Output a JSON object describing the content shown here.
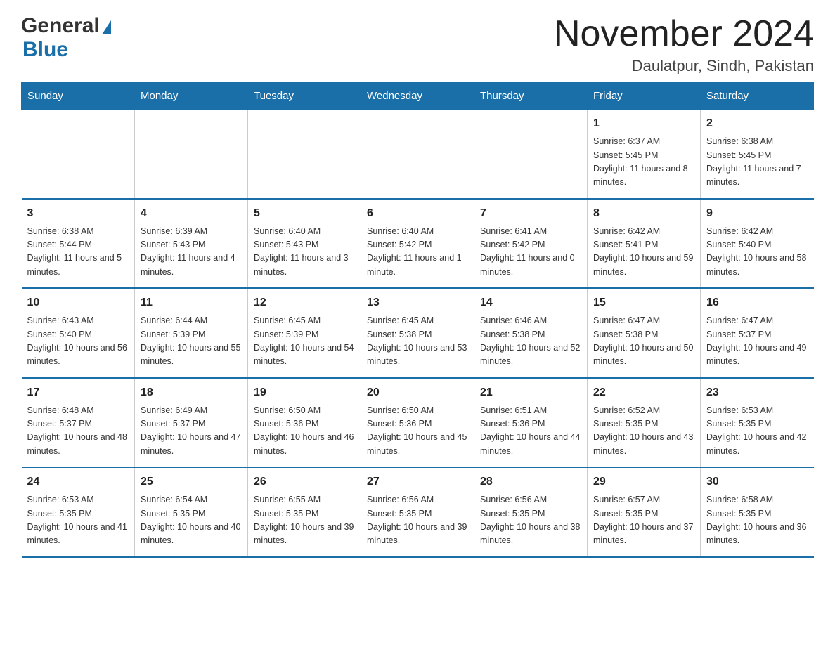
{
  "logo": {
    "general": "General",
    "blue": "Blue",
    "tagline": "GeneralBlue"
  },
  "title": "November 2024",
  "subtitle": "Daulatpur, Sindh, Pakistan",
  "days_of_week": [
    "Sunday",
    "Monday",
    "Tuesday",
    "Wednesday",
    "Thursday",
    "Friday",
    "Saturday"
  ],
  "weeks": [
    [
      {
        "day": "",
        "info": ""
      },
      {
        "day": "",
        "info": ""
      },
      {
        "day": "",
        "info": ""
      },
      {
        "day": "",
        "info": ""
      },
      {
        "day": "",
        "info": ""
      },
      {
        "day": "1",
        "info": "Sunrise: 6:37 AM\nSunset: 5:45 PM\nDaylight: 11 hours and 8 minutes."
      },
      {
        "day": "2",
        "info": "Sunrise: 6:38 AM\nSunset: 5:45 PM\nDaylight: 11 hours and 7 minutes."
      }
    ],
    [
      {
        "day": "3",
        "info": "Sunrise: 6:38 AM\nSunset: 5:44 PM\nDaylight: 11 hours and 5 minutes."
      },
      {
        "day": "4",
        "info": "Sunrise: 6:39 AM\nSunset: 5:43 PM\nDaylight: 11 hours and 4 minutes."
      },
      {
        "day": "5",
        "info": "Sunrise: 6:40 AM\nSunset: 5:43 PM\nDaylight: 11 hours and 3 minutes."
      },
      {
        "day": "6",
        "info": "Sunrise: 6:40 AM\nSunset: 5:42 PM\nDaylight: 11 hours and 1 minute."
      },
      {
        "day": "7",
        "info": "Sunrise: 6:41 AM\nSunset: 5:42 PM\nDaylight: 11 hours and 0 minutes."
      },
      {
        "day": "8",
        "info": "Sunrise: 6:42 AM\nSunset: 5:41 PM\nDaylight: 10 hours and 59 minutes."
      },
      {
        "day": "9",
        "info": "Sunrise: 6:42 AM\nSunset: 5:40 PM\nDaylight: 10 hours and 58 minutes."
      }
    ],
    [
      {
        "day": "10",
        "info": "Sunrise: 6:43 AM\nSunset: 5:40 PM\nDaylight: 10 hours and 56 minutes."
      },
      {
        "day": "11",
        "info": "Sunrise: 6:44 AM\nSunset: 5:39 PM\nDaylight: 10 hours and 55 minutes."
      },
      {
        "day": "12",
        "info": "Sunrise: 6:45 AM\nSunset: 5:39 PM\nDaylight: 10 hours and 54 minutes."
      },
      {
        "day": "13",
        "info": "Sunrise: 6:45 AM\nSunset: 5:38 PM\nDaylight: 10 hours and 53 minutes."
      },
      {
        "day": "14",
        "info": "Sunrise: 6:46 AM\nSunset: 5:38 PM\nDaylight: 10 hours and 52 minutes."
      },
      {
        "day": "15",
        "info": "Sunrise: 6:47 AM\nSunset: 5:38 PM\nDaylight: 10 hours and 50 minutes."
      },
      {
        "day": "16",
        "info": "Sunrise: 6:47 AM\nSunset: 5:37 PM\nDaylight: 10 hours and 49 minutes."
      }
    ],
    [
      {
        "day": "17",
        "info": "Sunrise: 6:48 AM\nSunset: 5:37 PM\nDaylight: 10 hours and 48 minutes."
      },
      {
        "day": "18",
        "info": "Sunrise: 6:49 AM\nSunset: 5:37 PM\nDaylight: 10 hours and 47 minutes."
      },
      {
        "day": "19",
        "info": "Sunrise: 6:50 AM\nSunset: 5:36 PM\nDaylight: 10 hours and 46 minutes."
      },
      {
        "day": "20",
        "info": "Sunrise: 6:50 AM\nSunset: 5:36 PM\nDaylight: 10 hours and 45 minutes."
      },
      {
        "day": "21",
        "info": "Sunrise: 6:51 AM\nSunset: 5:36 PM\nDaylight: 10 hours and 44 minutes."
      },
      {
        "day": "22",
        "info": "Sunrise: 6:52 AM\nSunset: 5:35 PM\nDaylight: 10 hours and 43 minutes."
      },
      {
        "day": "23",
        "info": "Sunrise: 6:53 AM\nSunset: 5:35 PM\nDaylight: 10 hours and 42 minutes."
      }
    ],
    [
      {
        "day": "24",
        "info": "Sunrise: 6:53 AM\nSunset: 5:35 PM\nDaylight: 10 hours and 41 minutes."
      },
      {
        "day": "25",
        "info": "Sunrise: 6:54 AM\nSunset: 5:35 PM\nDaylight: 10 hours and 40 minutes."
      },
      {
        "day": "26",
        "info": "Sunrise: 6:55 AM\nSunset: 5:35 PM\nDaylight: 10 hours and 39 minutes."
      },
      {
        "day": "27",
        "info": "Sunrise: 6:56 AM\nSunset: 5:35 PM\nDaylight: 10 hours and 39 minutes."
      },
      {
        "day": "28",
        "info": "Sunrise: 6:56 AM\nSunset: 5:35 PM\nDaylight: 10 hours and 38 minutes."
      },
      {
        "day": "29",
        "info": "Sunrise: 6:57 AM\nSunset: 5:35 PM\nDaylight: 10 hours and 37 minutes."
      },
      {
        "day": "30",
        "info": "Sunrise: 6:58 AM\nSunset: 5:35 PM\nDaylight: 10 hours and 36 minutes."
      }
    ]
  ]
}
